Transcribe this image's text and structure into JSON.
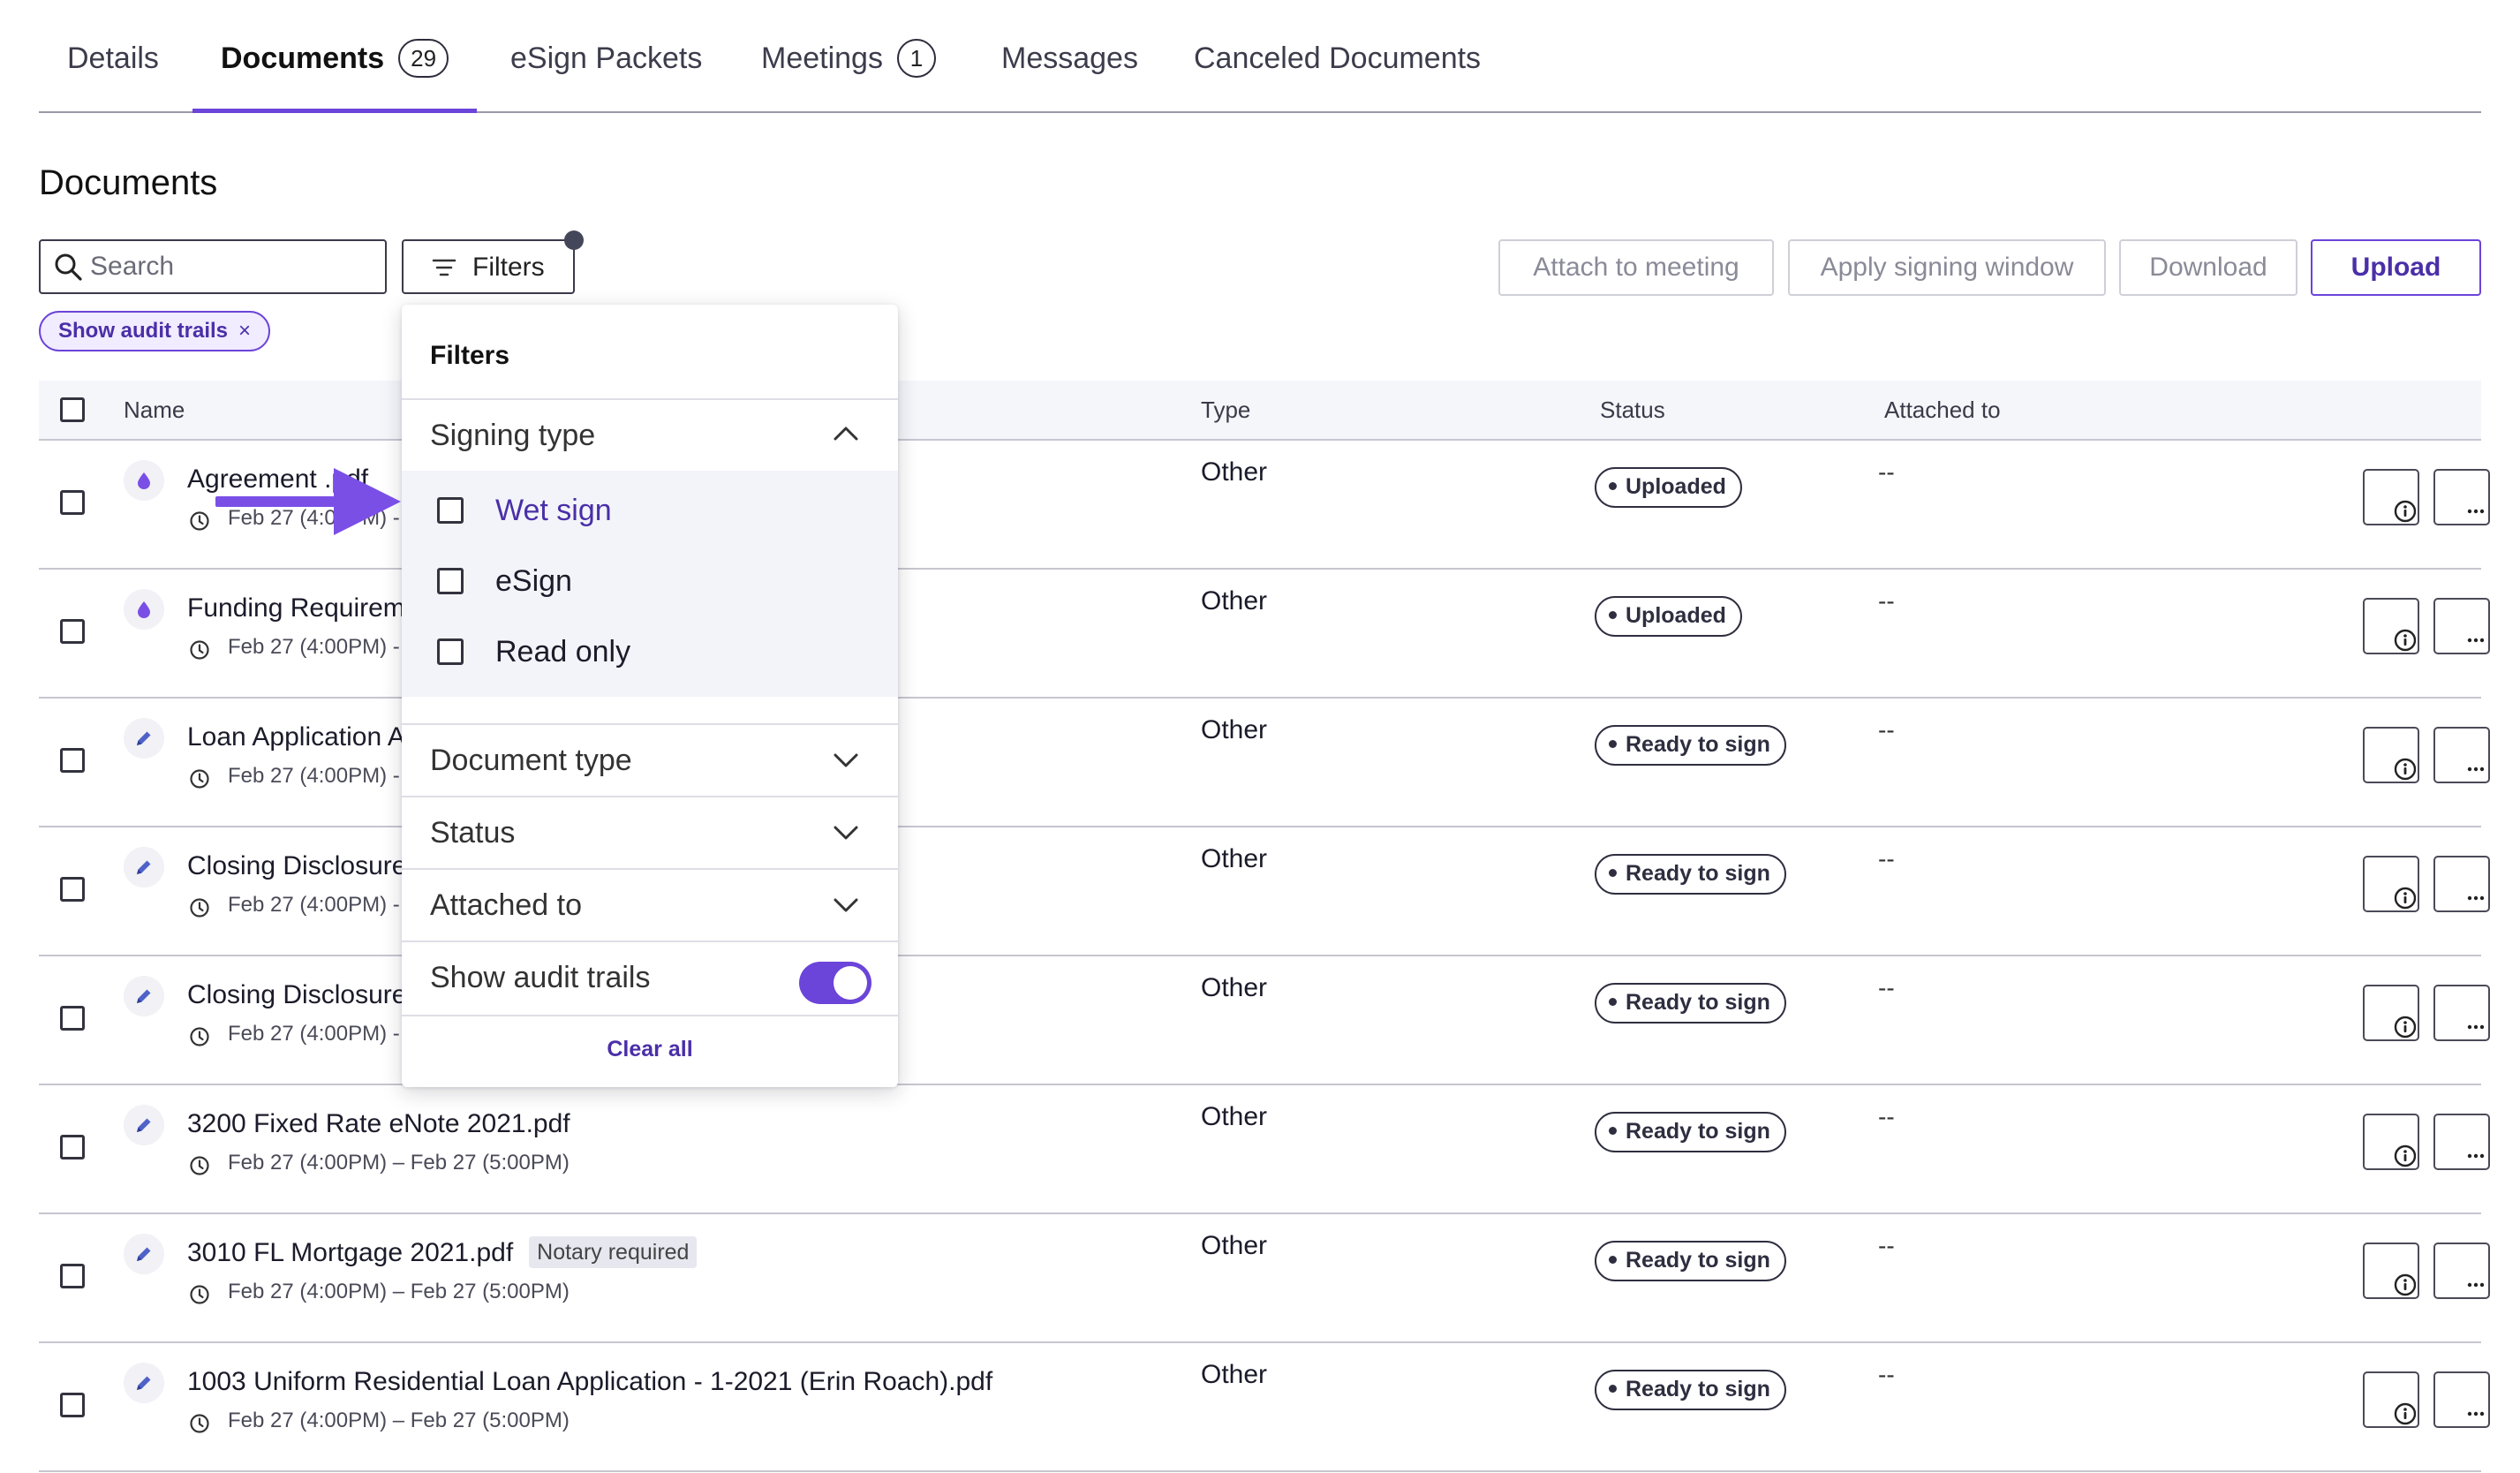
{
  "tabs": [
    {
      "label": "Details"
    },
    {
      "label": "Documents",
      "count": "29"
    },
    {
      "label": "eSign Packets"
    },
    {
      "label": "Meetings",
      "count": "1"
    },
    {
      "label": "Messages"
    },
    {
      "label": "Canceled Documents"
    }
  ],
  "section_title": "Documents",
  "search": {
    "placeholder": "Search"
  },
  "filters_button": {
    "label": "Filters"
  },
  "active_chip": {
    "label": "Show audit trails",
    "close": "×"
  },
  "actions": {
    "attach": "Attach to meeting",
    "apply": "Apply signing window",
    "download": "Download",
    "upload": "Upload"
  },
  "table": {
    "headers": {
      "name": "Name",
      "type": "Type",
      "status": "Status",
      "attached": "Attached to"
    },
    "rows": [
      {
        "name": "Agreement .pdf",
        "dates": "Feb 27 (4:00PM) -",
        "type": "Other",
        "status": "Uploaded",
        "attached": "--",
        "icon": "drop-icon"
      },
      {
        "name": "Funding Requirem",
        "dates": "Feb 27 (4:00PM) -",
        "type": "Other",
        "status": "Uploaded",
        "attached": "--",
        "icon": "drop-icon"
      },
      {
        "name": "Loan Application A",
        "dates": "Feb 27 (4:00PM) -",
        "type": "Other",
        "status": "Ready to sign",
        "attached": "--",
        "icon": "pen-icon"
      },
      {
        "name": "Closing Disclosure",
        "dates": "Feb 27 (4:00PM) -",
        "type": "Other",
        "status": "Ready to sign",
        "attached": "--",
        "icon": "pen-icon"
      },
      {
        "name": "Closing Disclosure",
        "dates": "Feb 27 (4:00PM) -",
        "type": "Other",
        "status": "Ready to sign",
        "attached": "--",
        "icon": "pen-icon"
      },
      {
        "name": "3200 Fixed Rate eNote 2021.pdf",
        "dates": "Feb 27 (4:00PM) – Feb 27 (5:00PM)",
        "type": "Other",
        "status": "Ready to sign",
        "attached": "--",
        "icon": "pen-icon"
      },
      {
        "name": "3010 FL Mortgage 2021.pdf",
        "tag": "Notary required",
        "dates": "Feb 27 (4:00PM) – Feb 27 (5:00PM)",
        "type": "Other",
        "status": "Ready to sign",
        "attached": "--",
        "icon": "pen-icon"
      },
      {
        "name": "1003 Uniform Residential Loan Application - 1-2021 (Erin Roach).pdf",
        "dates": "Feb 27 (4:00PM) – Feb 27 (5:00PM)",
        "type": "Other",
        "status": "Ready to sign",
        "attached": "--",
        "icon": "pen-icon"
      }
    ]
  },
  "filter_panel": {
    "title": "Filters",
    "signing_type": {
      "label": "Signing type",
      "expanded": true,
      "options": [
        {
          "label": "Wet sign",
          "checked": false
        },
        {
          "label": "eSign",
          "checked": false
        },
        {
          "label": "Read only",
          "checked": false
        }
      ]
    },
    "document_type": {
      "label": "Document type"
    },
    "status": {
      "label": "Status"
    },
    "attached_to": {
      "label": "Attached to"
    },
    "show_audit_trails": {
      "label": "Show audit trails",
      "on": true
    },
    "clear_all": "Clear all"
  },
  "colors": {
    "accent": "#6b44d9",
    "accent_dark": "#4a2fa8",
    "header_bg": "#f5f6fa",
    "arrow": "#7a4fe6"
  }
}
